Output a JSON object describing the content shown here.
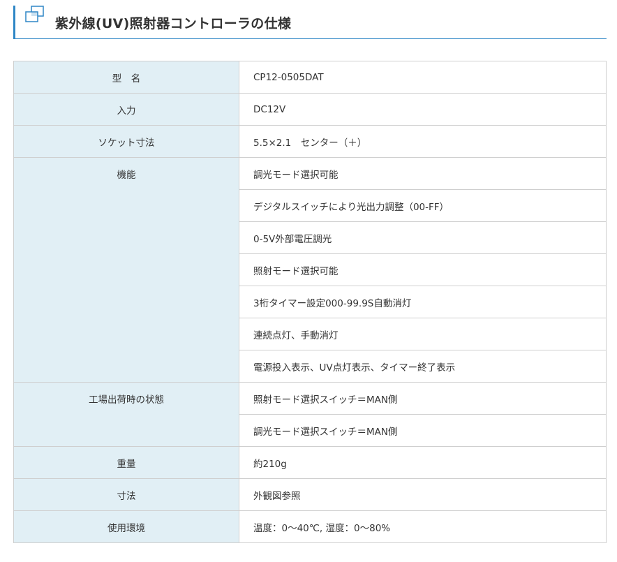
{
  "title": "紫外線(UV)照射器コントローラの仕様",
  "spec_rows": [
    {
      "label": "型　名",
      "values": [
        "CP12-0505DAT"
      ]
    },
    {
      "label": "入力",
      "values": [
        "DC12V"
      ]
    },
    {
      "label": "ソケット寸法",
      "values": [
        "5.5×2.1　センター（＋）"
      ]
    },
    {
      "label": "機能",
      "values": [
        "調光モード選択可能",
        "デジタルスイッチにより光出力調整（00-FF）",
        "0-5V外部電圧調光",
        "照射モード選択可能",
        "3桁タイマー設定000-99.9S自動消灯",
        "連続点灯、手動消灯",
        "電源投入表示、UV点灯表示、タイマー終了表示"
      ]
    },
    {
      "label": "工場出荷時の状態",
      "values": [
        "照射モード選択スイッチ＝MAN側",
        "調光モード選択スイッチ＝MAN側"
      ]
    },
    {
      "label": "重量",
      "values": [
        "約210g"
      ]
    },
    {
      "label": "寸法",
      "values": [
        "外観図参照"
      ]
    },
    {
      "label": "使用環境",
      "values": [
        "温度：0～40℃, 湿度：0～80%"
      ]
    }
  ],
  "colors": {
    "accent": "#2f86c6",
    "header_bg": "#e1eff5",
    "border": "#cfcfcf"
  }
}
